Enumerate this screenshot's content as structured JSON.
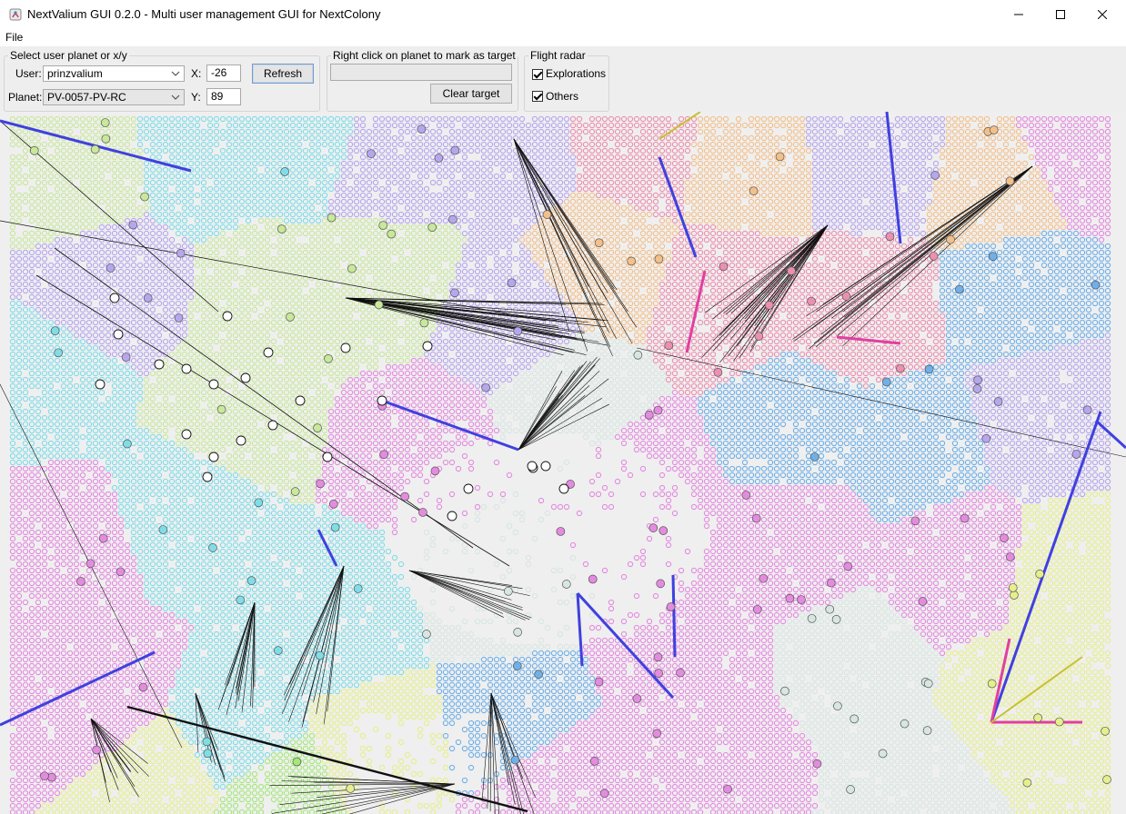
{
  "window": {
    "title": "NextValium GUI 0.2.0 - Multi user management GUI for NextColony",
    "minimize_glyph": "—",
    "maximize_glyph": "☐",
    "close_glyph": "✕"
  },
  "menu": {
    "file": "File"
  },
  "select_group": {
    "title": "Select user planet or x/y",
    "user_label": "User:",
    "user_value": "prinzvalium",
    "planet_label": "Planet:",
    "planet_value": "PV-0057-PV-RC",
    "x_label": "X:",
    "x_value": "-26",
    "y_label": "Y:",
    "y_value": "89",
    "refresh": "Refresh"
  },
  "target_group": {
    "title": "Right click on planet to mark as target",
    "target_value": "",
    "clear": "Clear target"
  },
  "radar_group": {
    "title": "Flight radar",
    "explorations": "Explorations",
    "explorations_checked": true,
    "others": "Others",
    "others_checked": true
  },
  "map": {
    "background": "#efefef",
    "region_colors": [
      "#c8e89a",
      "#e48be0",
      "#6fb0e8",
      "#7fdde8",
      "#b7a6ee",
      "#ec8fb0",
      "#f3c08a",
      "#a5e87a",
      "#e6ef8a",
      "#d7e6e1"
    ],
    "track_colors": {
      "explorations": "#4040e0",
      "others": "#101010",
      "transport": "#e040a0",
      "yellow": "#c8c030"
    }
  }
}
